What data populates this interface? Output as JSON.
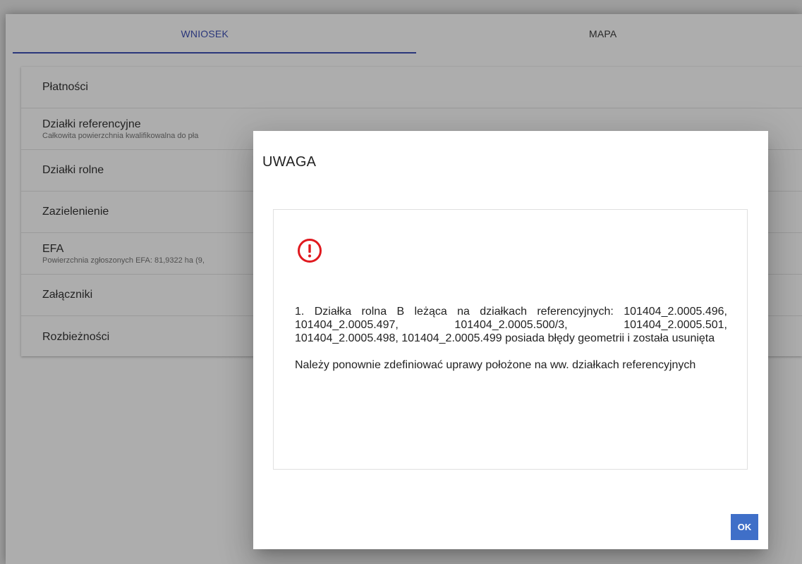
{
  "tabs": [
    {
      "label": "WNIOSEK",
      "active": true
    },
    {
      "label": "MAPA",
      "active": false
    }
  ],
  "panel": {
    "items": [
      {
        "title": "Płatności",
        "sub": ""
      },
      {
        "title": "Działki referencyjne",
        "sub": "Całkowita powierzchnia kwalifikowalna do pła"
      },
      {
        "title": "Działki rolne",
        "sub": ""
      },
      {
        "title": "Zazielenienie",
        "sub": ""
      },
      {
        "title": "EFA",
        "sub": "Powierzchnia zgłoszonych EFA: 81,9322 ha (9,"
      },
      {
        "title": "Załączniki",
        "sub": ""
      },
      {
        "title": "Rozbieżności",
        "sub": ""
      }
    ]
  },
  "dialog": {
    "title": "UWAGA",
    "icon": "exclamation-circle-icon",
    "icon_color": "#e0191f",
    "message_1": "1. Działka rolna B leżąca na działkach referencyjnych: 101404_2.0005.496, 101404_2.0005.497, 101404_2.0005.500/3, 101404_2.0005.501, 101404_2.0005.498, 101404_2.0005.499 posiada błędy geometrii i została usunięta",
    "message_2": "Należy ponownie zdefiniować uprawy położone na ww. działkach referencyjnych",
    "ok_label": "OK"
  },
  "colors": {
    "accent": "#3f51b5",
    "ok_button": "#3f6fc8"
  }
}
